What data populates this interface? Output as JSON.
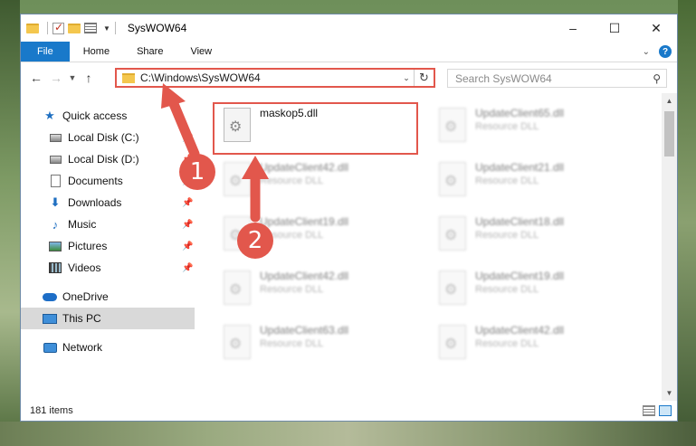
{
  "window": {
    "title": "SysWOW64",
    "controls": [
      "–",
      "☐",
      "✕"
    ]
  },
  "ribbon": {
    "tabs": [
      "File",
      "Home",
      "Share",
      "View"
    ]
  },
  "nav": {
    "address": "C:\\Windows\\SysWOW64",
    "search_placeholder": "Search SysWOW64"
  },
  "sidebar": {
    "items": [
      {
        "label": "Quick access",
        "icon": "star-icon"
      },
      {
        "label": "Local Disk (C:)",
        "icon": "drive-icon"
      },
      {
        "label": "Local Disk (D:)",
        "icon": "drive-icon"
      },
      {
        "label": "Documents",
        "icon": "documents-icon"
      },
      {
        "label": "Downloads",
        "icon": "downloads-icon"
      },
      {
        "label": "Music",
        "icon": "music-icon"
      },
      {
        "label": "Pictures",
        "icon": "pictures-icon"
      },
      {
        "label": "Videos",
        "icon": "videos-icon"
      },
      {
        "label": "OneDrive",
        "icon": "onedrive-icon"
      },
      {
        "label": "This PC",
        "icon": "this-pc-icon"
      },
      {
        "label": "Network",
        "icon": "network-icon"
      }
    ]
  },
  "files": [
    {
      "name": "maskop5.dll",
      "type": ""
    },
    {
      "name": "UpdateClient65.dll",
      "type": "Resource DLL"
    },
    {
      "name": "UpdateClient42.dll",
      "type": "Resource DLL"
    },
    {
      "name": "UpdateClient21.dll",
      "type": "Resource DLL"
    },
    {
      "name": "UpdateClient19.dll",
      "type": "Resource DLL"
    },
    {
      "name": "UpdateClient18.dll",
      "type": "Resource DLL"
    },
    {
      "name": "UpdateClient42.dll",
      "type": "Resource DLL"
    },
    {
      "name": "UpdateClient19.dll",
      "type": "Resource DLL"
    },
    {
      "name": "UpdateClient63.dll",
      "type": "Resource DLL"
    },
    {
      "name": "UpdateClient42.dll",
      "type": "Resource DLL"
    }
  ],
  "status": {
    "count": "181 items"
  },
  "annotations": {
    "badge1": "1",
    "badge2": "2",
    "accent": "#e2574c"
  }
}
